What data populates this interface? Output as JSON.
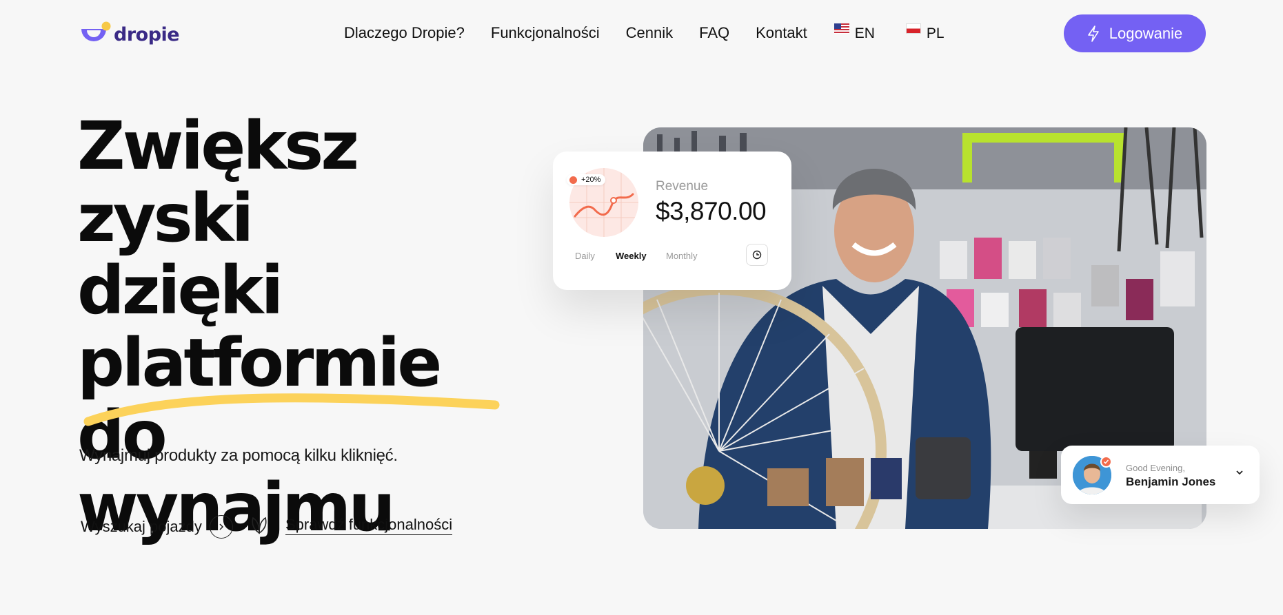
{
  "brand": {
    "name": "dropie",
    "colors": {
      "primary": "#7461f3",
      "logo_text": "#3a2a86",
      "logo_dot": "#f7c948",
      "highlight": "#fcd25a",
      "accent_orange": "#f26b4c"
    }
  },
  "nav": {
    "items": [
      "Dlaczego Dropie?",
      "Funkcjonalności",
      "Cennik",
      "FAQ",
      "Kontakt"
    ],
    "languages": [
      {
        "code": "EN",
        "flag": "us-flag-icon"
      },
      {
        "code": "PL",
        "flag": "pl-flag-icon"
      }
    ],
    "login_label": "Logowanie",
    "login_icon": "lightning-icon"
  },
  "hero": {
    "title_lines": [
      "Zwiększ zyski",
      "dzięki",
      "platformie do",
      "wynajmu"
    ],
    "subtitle": "Wynajmuj produkty za pomocą kilku kliknięć.",
    "cta_search": "Wyszukaj pojazdy",
    "cta_features": "Sprawdź funkcjonalności"
  },
  "revenue_card": {
    "badge": "+20%",
    "label": "Revenue",
    "value": "$3,870.00",
    "periods": [
      "Daily",
      "Weekly",
      "Monthly"
    ],
    "active_period": "Weekly"
  },
  "greeting_card": {
    "greeting": "Good Evening,",
    "name": "Benjamin Jones"
  }
}
